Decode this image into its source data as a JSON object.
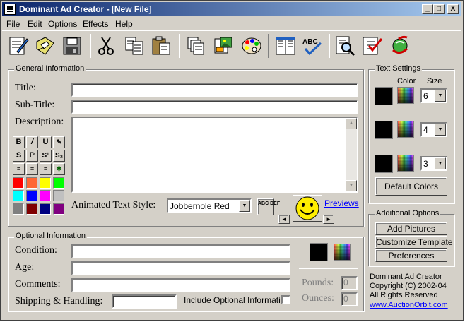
{
  "window": {
    "title": "Dominant Ad Creator - [New File]",
    "min": "_",
    "max": "□",
    "close": "X"
  },
  "menu": [
    "File",
    "Edit",
    "Options",
    "Effects",
    "Help"
  ],
  "toolbar": {
    "icons": [
      "edit-document-icon",
      "open-folder-icon",
      "save-disk-icon",
      "cut-scissors-icon",
      "copy-icon",
      "paste-clipboard-icon",
      "copy-pages-icon",
      "insert-picture-icon",
      "color-palette-icon",
      "preview-book-icon",
      "spell-check-icon",
      "search-document-icon",
      "checklist-icon",
      "web-refresh-icon"
    ],
    "spell_label": "ABC"
  },
  "general": {
    "group_label": "General Information",
    "title_label": "Title:",
    "subtitle_label": "Sub-Title:",
    "description_label": "Description:",
    "title_value": "",
    "subtitle_value": "",
    "description_value": "",
    "format_buttons": [
      [
        "B",
        "/",
        "U",
        "✎"
      ],
      [
        "S",
        "P",
        "S¹",
        "S₂"
      ],
      [
        "≡",
        "≡",
        "≡",
        "✱"
      ]
    ],
    "swatches": [
      "#ff0000",
      "#ff6633",
      "#ffff00",
      "#00ff00",
      "#00ffff",
      "#0000ff",
      "#ff00ff",
      "#c0c0c0",
      "#808080",
      "#800000",
      "#000080",
      "#800080"
    ],
    "animated_label": "Animated Text Style:",
    "animated_value": "Jobbernole Red",
    "abc_def": "ABC DEF",
    "previews": "Previews",
    "prev_arrow": "◄",
    "next_arrow": "►"
  },
  "text_settings": {
    "group_label": "Text Settings",
    "color_header": "Color",
    "size_header": "Size",
    "sizes": [
      "6",
      "4",
      "3"
    ],
    "default_colors": "Default Colors",
    "colors": [
      "#000000",
      "#000000",
      "#000000"
    ]
  },
  "additional": {
    "group_label": "Additional Options",
    "add_pictures": "Add Pictures",
    "customize_template": "Customize Template",
    "preferences": "Preferences"
  },
  "optional": {
    "group_label": "Optional Information",
    "condition_label": "Condition:",
    "age_label": "Age:",
    "comments_label": "Comments:",
    "shipping_label": "Shipping & Handling:",
    "include_label": "Include Optional Information",
    "pounds_label": "Pounds:",
    "pounds_value": "0",
    "ounces_label": "Ounces:",
    "ounces_value": "0"
  },
  "about": {
    "line1": "Dominant Ad Creator",
    "line2": "Copyright (C) 2002-04",
    "line3": "All Rights Reserved",
    "url": "www.AuctionOrbit.com"
  }
}
